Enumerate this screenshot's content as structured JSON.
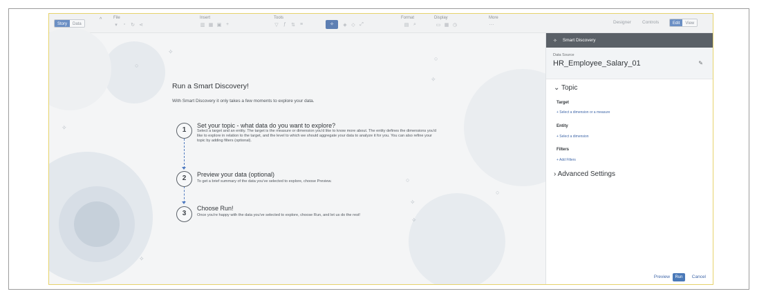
{
  "toolbar": {
    "story_label": "Story",
    "data_label": "Data",
    "groups": {
      "file": "File",
      "insert": "Insert",
      "tools": "Tools",
      "format": "Format",
      "display": "Display",
      "more": "More"
    },
    "right": {
      "designer": "Designer",
      "controls": "Controls",
      "edit": "Edit",
      "view": "View"
    }
  },
  "main": {
    "title": "Run a Smart Discovery!",
    "subtitle": "With Smart Discovery it only takes a few moments to explore your data.",
    "steps": [
      {
        "number": "1",
        "title": "Set your topic - what data do you want to explore?",
        "desc": "Select a target and an entity. The target is the measure or dimension you'd like to know more about. The entity defines the dimensions you'd like to explore in relation to the target, and the level to which we should aggregate your data to analyze it for you. You can also refine your topic by adding filters (optional)."
      },
      {
        "number": "2",
        "title": "Preview your data (optional)",
        "desc": "To get a brief summary of the data you've selected to explore, choose Preview."
      },
      {
        "number": "3",
        "title": "Choose Run!",
        "desc": "Once you're happy with the data you've selected to explore, choose Run, and let us do the rest!"
      }
    ]
  },
  "panel": {
    "header": "Smart Discovery",
    "data_source_label": "Data Source",
    "data_source_value": "HR_Employee_Salary_01",
    "topic": "Topic",
    "target_label": "Target",
    "target_link": "+ Select a dimension or a measure",
    "entity_label": "Entity",
    "entity_link": "+ Select a dimension",
    "filters_label": "Filters",
    "filters_link": "+ Add Filters",
    "advanced": "Advanced Settings",
    "preview": "Preview",
    "run": "Run",
    "cancel": "Cancel"
  },
  "colors": {
    "accent": "#4a79b8",
    "panel_header": "#5a6067",
    "border_highlight": "#e6d26a"
  }
}
